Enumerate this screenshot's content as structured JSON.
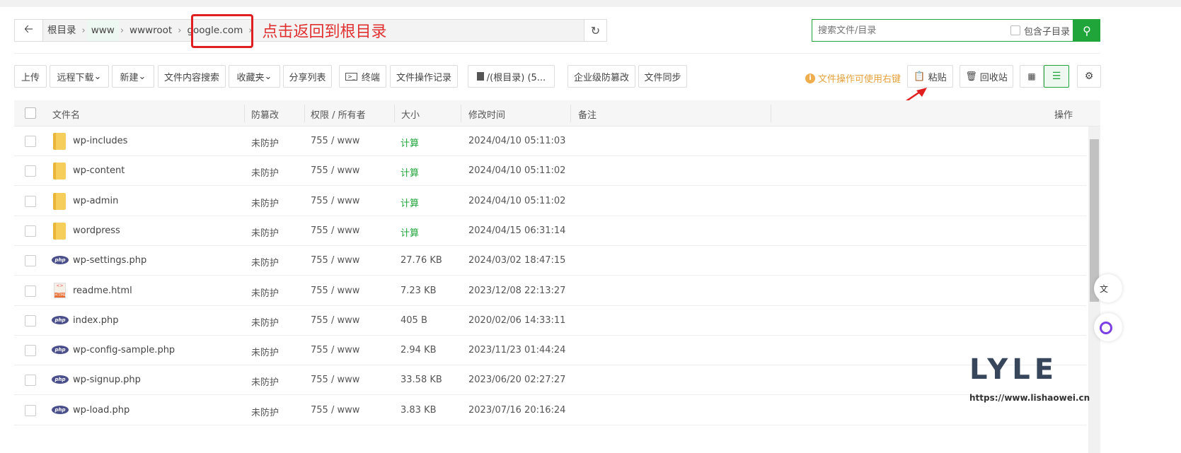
{
  "breadcrumb": {
    "items": [
      "根目录",
      "www",
      "wwwroot",
      "google.com"
    ],
    "annotation": "点击返回到根目录"
  },
  "search": {
    "placeholder": "搜索文件/目录",
    "include_sub": "包含子目录"
  },
  "toolbar": {
    "upload": "上传",
    "remote_download": "远程下载",
    "new": "新建",
    "content_search": "文件内容搜索",
    "favorites": "收藏夹",
    "share_list": "分享列表",
    "terminal": "终端",
    "op_log": "文件操作记录",
    "disk": "/(根目录) (5...",
    "tamper": "企业级防篡改",
    "sync": "文件同步",
    "tip": "文件操作可使用右键",
    "paste": "粘贴",
    "recycle": "回收站"
  },
  "table": {
    "headers": {
      "name": "文件名",
      "tamper": "防篡改",
      "perm": "权限 / 所有者",
      "size": "大小",
      "mtime": "修改时间",
      "note": "备注",
      "ops": "操作"
    },
    "rows": [
      {
        "type": "folder",
        "name": "wp-includes",
        "tamper": "未防护",
        "perm": "755 / www",
        "size": "计算",
        "mtime": "2024/04/10 05:11:03"
      },
      {
        "type": "folder",
        "name": "wp-content",
        "tamper": "未防护",
        "perm": "755 / www",
        "size": "计算",
        "mtime": "2024/04/10 05:11:02"
      },
      {
        "type": "folder",
        "name": "wp-admin",
        "tamper": "未防护",
        "perm": "755 / www",
        "size": "计算",
        "mtime": "2024/04/10 05:11:02"
      },
      {
        "type": "folder",
        "name": "wordpress",
        "tamper": "未防护",
        "perm": "755 / www",
        "size": "计算",
        "mtime": "2024/04/15 06:31:14"
      },
      {
        "type": "php",
        "name": "wp-settings.php",
        "tamper": "未防护",
        "perm": "755 / www",
        "size": "27.76 KB",
        "mtime": "2024/03/02 18:47:15"
      },
      {
        "type": "html",
        "name": "readme.html",
        "tamper": "未防护",
        "perm": "755 / www",
        "size": "7.23 KB",
        "mtime": "2023/12/08 22:13:27"
      },
      {
        "type": "php",
        "name": "index.php",
        "tamper": "未防护",
        "perm": "755 / www",
        "size": "405 B",
        "mtime": "2020/02/06 14:33:11"
      },
      {
        "type": "php",
        "name": "wp-config-sample.php",
        "tamper": "未防护",
        "perm": "755 / www",
        "size": "2.94 KB",
        "mtime": "2023/11/23 01:44:24"
      },
      {
        "type": "php",
        "name": "wp-signup.php",
        "tamper": "未防护",
        "perm": "755 / www",
        "size": "33.58 KB",
        "mtime": "2023/06/20 02:27:27"
      },
      {
        "type": "php",
        "name": "wp-load.php",
        "tamper": "未防护",
        "perm": "755 / www",
        "size": "3.83 KB",
        "mtime": "2023/07/16 20:16:24"
      }
    ]
  },
  "watermark": {
    "logo": "LYLE",
    "url": "https://www.lishaowei.cn"
  },
  "float": {
    "translate": "文"
  }
}
